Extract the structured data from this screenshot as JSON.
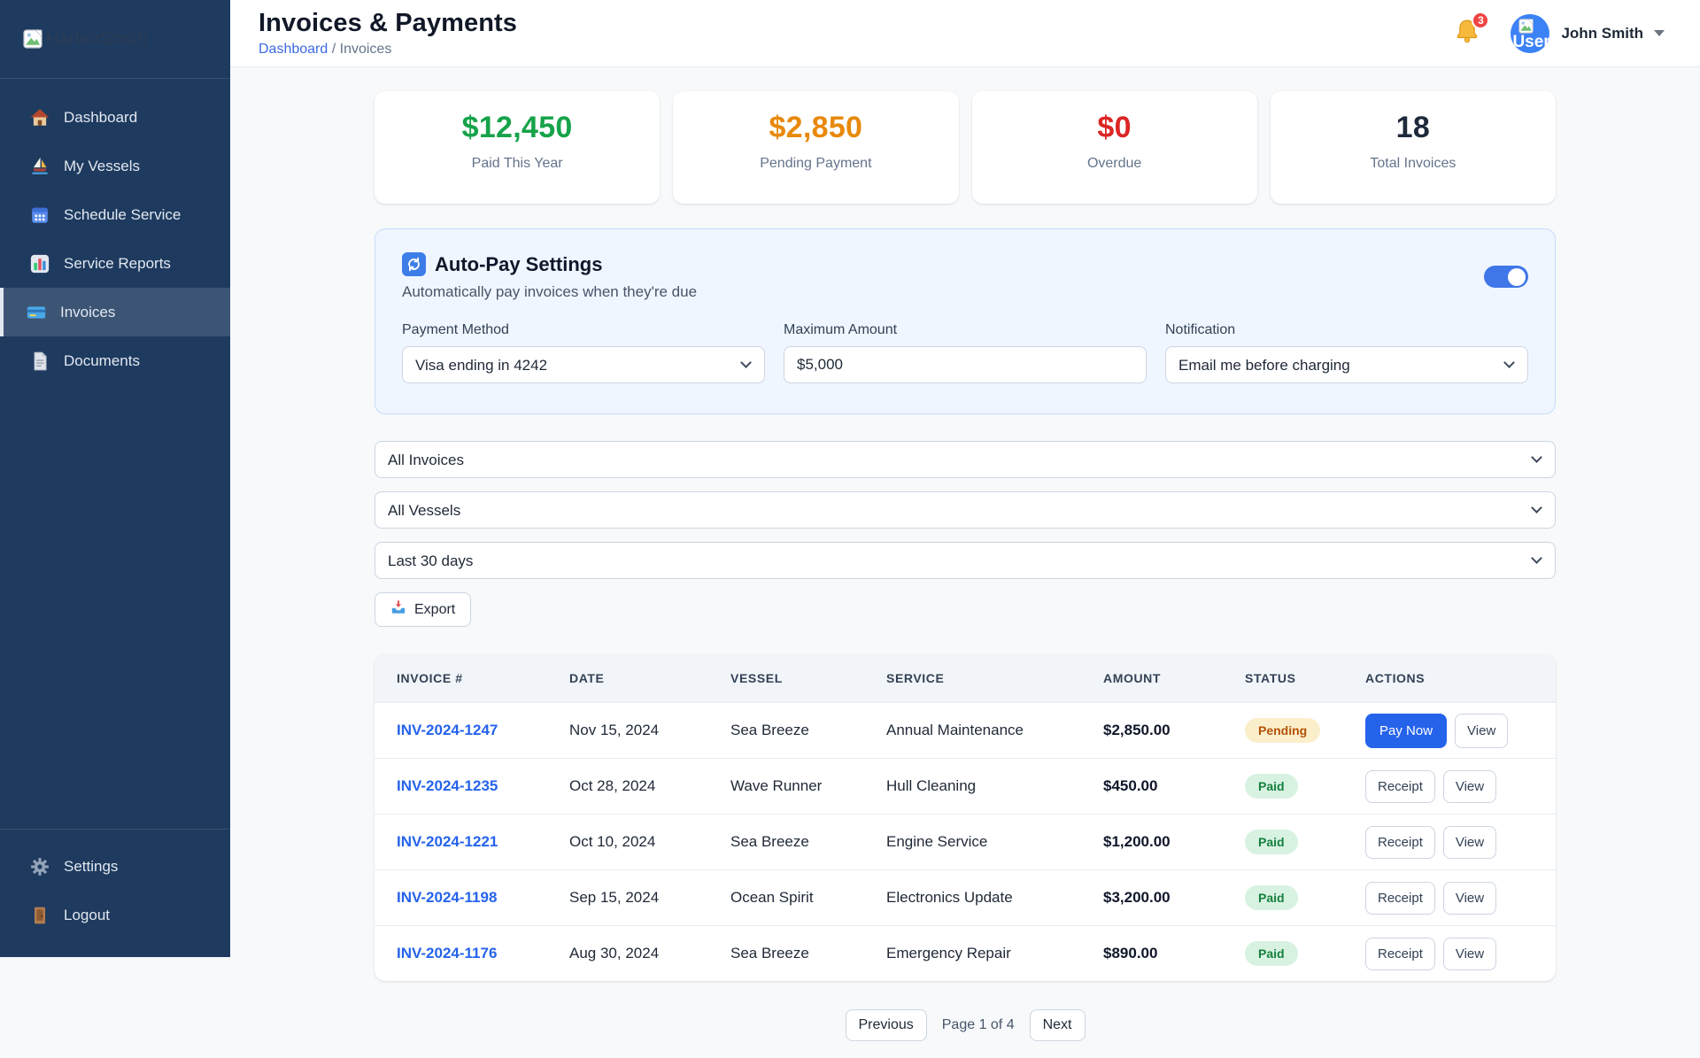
{
  "sidebar": {
    "logo_alt": "HarborSmith",
    "items": [
      {
        "label": "Dashboard",
        "icon": "home-icon",
        "active": false
      },
      {
        "label": "My Vessels",
        "icon": "sailboat-icon",
        "active": false
      },
      {
        "label": "Schedule Service",
        "icon": "calendar-icon",
        "active": false
      },
      {
        "label": "Service Reports",
        "icon": "bar-chart-icon",
        "active": false
      },
      {
        "label": "Invoices",
        "icon": "credit-card-icon",
        "active": true
      },
      {
        "label": "Documents",
        "icon": "document-icon",
        "active": false
      }
    ],
    "footer_items": [
      {
        "label": "Settings",
        "icon": "gear-icon",
        "active": false
      },
      {
        "label": "Logout",
        "icon": "door-icon",
        "active": false
      }
    ]
  },
  "header": {
    "title": "Invoices & Payments",
    "breadcrumb": {
      "home": "Dashboard",
      "separator": "/",
      "current": "Invoices"
    },
    "notification_count": "3",
    "avatar_alt": "User",
    "user_name": "John Smith"
  },
  "stats": [
    {
      "value": "$12,450",
      "label": "Paid This Year",
      "color": "#16a34a"
    },
    {
      "value": "$2,850",
      "label": "Pending Payment",
      "color": "#e8890b"
    },
    {
      "value": "$0",
      "label": "Overdue",
      "color": "#dc2626"
    },
    {
      "value": "18",
      "label": "Total Invoices",
      "color": "#1e293b"
    }
  ],
  "autopay": {
    "icon": "sync-icon",
    "title": "Auto-Pay Settings",
    "subtitle": "Automatically pay invoices when they're due",
    "enabled": true,
    "fields": {
      "payment_method": {
        "label": "Payment Method",
        "value": "Visa ending in 4242"
      },
      "maximum_amount": {
        "label": "Maximum Amount",
        "value": "$5,000"
      },
      "notification": {
        "label": "Notification",
        "value": "Email me before charging"
      }
    }
  },
  "filters": {
    "status_filter": "All Invoices",
    "vessel_filter": "All Vessels",
    "date_filter": "Last 30 days",
    "export_label": "Export",
    "export_icon": "inbox-tray-icon"
  },
  "table": {
    "columns": [
      "INVOICE #",
      "DATE",
      "VESSEL",
      "SERVICE",
      "AMOUNT",
      "STATUS",
      "ACTIONS"
    ],
    "rows": [
      {
        "invoice": "INV-2024-1247",
        "date": "Nov 15, 2024",
        "vessel": "Sea Breeze",
        "service": "Annual Maintenance",
        "amount": "$2,850.00",
        "status": "Pending",
        "actions": [
          {
            "label": "Pay Now",
            "style": "primary"
          },
          {
            "label": "View",
            "style": "default"
          }
        ]
      },
      {
        "invoice": "INV-2024-1235",
        "date": "Oct 28, 2024",
        "vessel": "Wave Runner",
        "service": "Hull Cleaning",
        "amount": "$450.00",
        "status": "Paid",
        "actions": [
          {
            "label": "Receipt",
            "style": "default"
          },
          {
            "label": "View",
            "style": "default"
          }
        ]
      },
      {
        "invoice": "INV-2024-1221",
        "date": "Oct 10, 2024",
        "vessel": "Sea Breeze",
        "service": "Engine Service",
        "amount": "$1,200.00",
        "status": "Paid",
        "actions": [
          {
            "label": "Receipt",
            "style": "default"
          },
          {
            "label": "View",
            "style": "default"
          }
        ]
      },
      {
        "invoice": "INV-2024-1198",
        "date": "Sep 15, 2024",
        "vessel": "Ocean Spirit",
        "service": "Electronics Update",
        "amount": "$3,200.00",
        "status": "Paid",
        "actions": [
          {
            "label": "Receipt",
            "style": "default"
          },
          {
            "label": "View",
            "style": "default"
          }
        ]
      },
      {
        "invoice": "INV-2024-1176",
        "date": "Aug 30, 2024",
        "vessel": "Sea Breeze",
        "service": "Emergency Repair",
        "amount": "$890.00",
        "status": "Paid",
        "actions": [
          {
            "label": "Receipt",
            "style": "default"
          },
          {
            "label": "View",
            "style": "default"
          }
        ]
      }
    ]
  },
  "pagination": {
    "previous": "Previous",
    "page_info": "Page 1 of 4",
    "next": "Next"
  },
  "colors": {
    "sidebar_bg": "#1e3a5f",
    "accent_blue": "#2563eb",
    "paid_green": "#16a34a",
    "pending_orange": "#e8890b",
    "overdue_red": "#dc2626",
    "panel_blue_bg": "#eff6ff"
  }
}
